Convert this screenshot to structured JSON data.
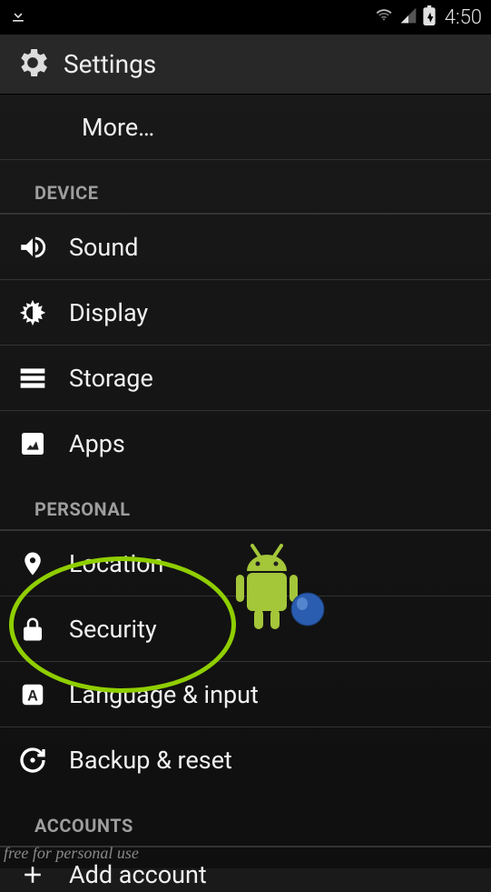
{
  "status": {
    "time": "4:50"
  },
  "header": {
    "title": "Settings"
  },
  "items": {
    "more": "More…",
    "sound": "Sound",
    "display": "Display",
    "storage": "Storage",
    "apps": "Apps",
    "location": "Location",
    "security": "Security",
    "language": "Language & input",
    "backup": "Backup & reset",
    "add_account": "Add account"
  },
  "sections": {
    "device": "DEVICE",
    "personal": "PERSONAL",
    "accounts": "ACCOUNTS"
  },
  "watermark": "free for personal use"
}
